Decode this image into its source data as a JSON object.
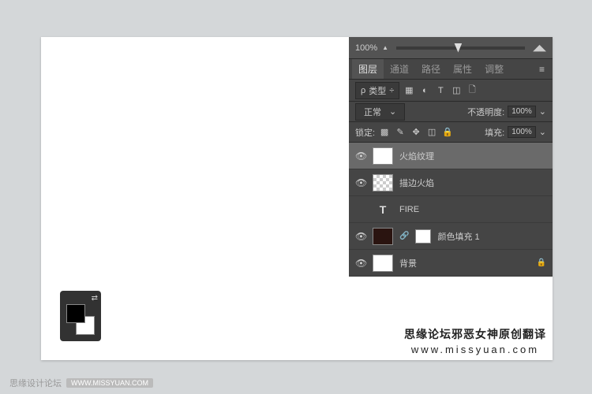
{
  "zoom": {
    "value": "100%"
  },
  "tabs": {
    "layers": "图层",
    "channels": "通道",
    "paths": "路径",
    "properties": "属性",
    "adjustments": "调整"
  },
  "filter": {
    "label": "类型",
    "search_icon": "ρ"
  },
  "blend": {
    "mode": "正常",
    "opacity_label": "不透明度:",
    "opacity": "100%"
  },
  "lock": {
    "label": "锁定:",
    "fill_label": "填充:",
    "fill": "100%"
  },
  "layers_list": [
    {
      "name": "火焰纹理",
      "type": "normal",
      "visible": true,
      "selected": true
    },
    {
      "name": "描边火焰",
      "type": "checker",
      "visible": true
    },
    {
      "name": "FIRE",
      "type": "text",
      "visible": false
    },
    {
      "name": "颜色填充 1",
      "type": "fill",
      "visible": true
    },
    {
      "name": "背景",
      "type": "bg",
      "visible": true,
      "locked": true
    }
  ],
  "watermark": {
    "line1": "思缘论坛邪恶女神原创翻译",
    "line2": "www.missyuan.com"
  },
  "footer": {
    "text": "思缘设计论坛",
    "badge": "WWW.MISSYUAN.COM"
  }
}
